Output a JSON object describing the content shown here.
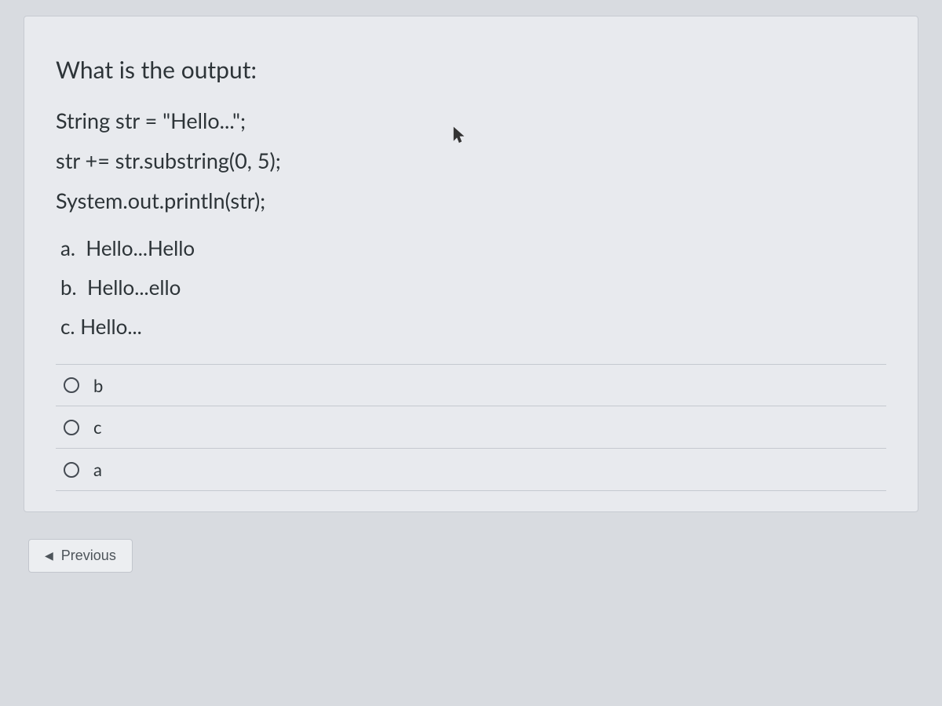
{
  "question": {
    "title": "What is the output:",
    "code_lines": [
      "String str = \"Hello...\";",
      "str += str.substring(0, 5);",
      "System.out.println(str);"
    ],
    "answers": [
      {
        "letter": "a.",
        "text": "Hello...Hello"
      },
      {
        "letter": "b.",
        "text": "Hello...ello"
      },
      {
        "letter": "c.",
        "text": "Hello..."
      }
    ],
    "options": [
      {
        "key": "b",
        "label": "b"
      },
      {
        "key": "c",
        "label": "c"
      },
      {
        "key": "a",
        "label": "a"
      }
    ]
  },
  "nav": {
    "previous_label": "Previous"
  }
}
